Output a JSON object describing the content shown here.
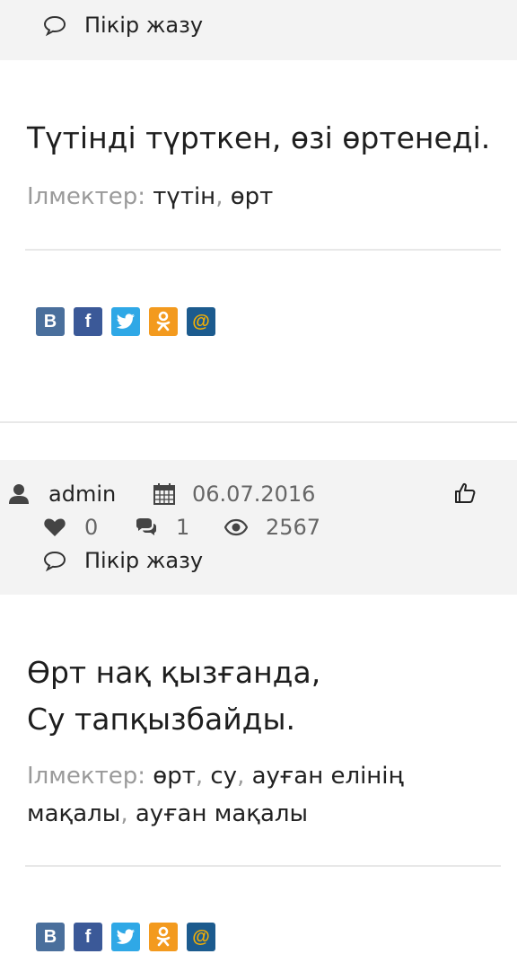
{
  "post1": {
    "comment_label": "Пікір жазу",
    "quote": "Түтінді түрткен, өзі өртенеді.",
    "tags_label": "Ілмектер:",
    "tags": [
      "түтін",
      "өрт"
    ]
  },
  "post2": {
    "author": "admin",
    "date": "06.07.2016",
    "likes": "0",
    "comments": "1",
    "views": "2567",
    "comment_label": "Пікір жазу",
    "quote_line1": "Өрт нақ қызғанда,",
    "quote_line2": "Су тапқызбайды.",
    "tags_label": "Ілмектер:",
    "tags": [
      "өрт",
      "су",
      "ауған елінің мақалы",
      "ауған мақалы"
    ]
  },
  "share": {
    "vk": "В",
    "fb": "f",
    "ok": "ok",
    "mail": "@"
  },
  "colors": {
    "meta_bg": "#f3f3f3",
    "icon": "#444444",
    "vk": "#4a6f9c",
    "facebook": "#3b5998",
    "twitter": "#2fa8e6",
    "odnoklassniki": "#f39a1e",
    "mailru": "#1c5b8e"
  }
}
